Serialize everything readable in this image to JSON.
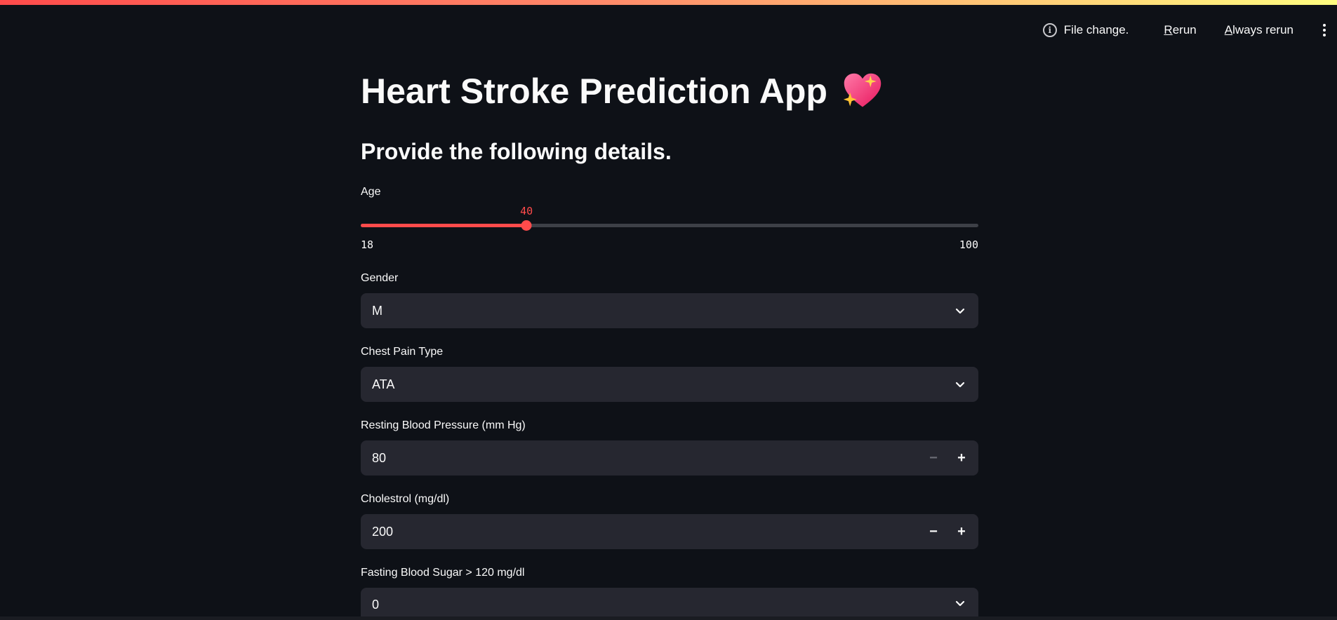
{
  "toolbar": {
    "status_text": "File change.",
    "rerun_underline": "R",
    "rerun_rest": "erun",
    "always_underline": "A",
    "always_rest": "lways rerun"
  },
  "page": {
    "title": "Heart Stroke Prediction App",
    "title_emoji_icon": "sparkling-heart-icon",
    "subtitle": "Provide the following details."
  },
  "form": {
    "age": {
      "label": "Age",
      "value": "40",
      "min": "18",
      "max": "100",
      "value_num": 40,
      "min_num": 18,
      "max_num": 100
    },
    "gender": {
      "label": "Gender",
      "value": "M"
    },
    "chest_pain": {
      "label": "Chest Pain Type",
      "value": "ATA"
    },
    "resting_bp": {
      "label": "Resting Blood Pressure (mm Hg)",
      "value": "80",
      "minus": "−",
      "plus": "+"
    },
    "cholesterol": {
      "label": "Cholestrol (mg/dl)",
      "value": "200",
      "minus": "−",
      "plus": "+"
    },
    "fasting_bs": {
      "label": "Fasting Blood Sugar > 120 mg/dl",
      "value": "0"
    }
  },
  "colors": {
    "accent": "#ff4b4b",
    "background": "#0e1117",
    "input_bg": "#262730"
  }
}
